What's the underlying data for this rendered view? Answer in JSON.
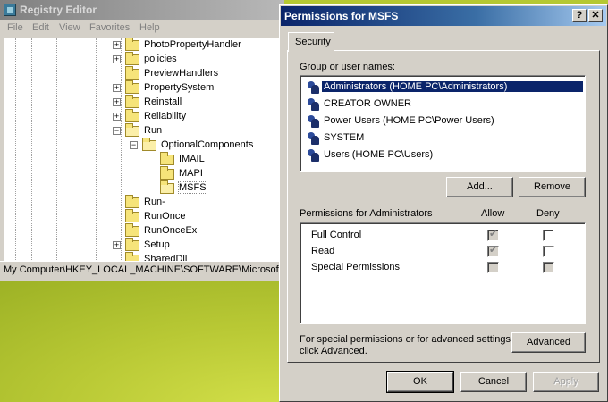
{
  "registry": {
    "title": "Registry Editor",
    "menu": [
      "File",
      "Edit",
      "View",
      "Favorites",
      "Help"
    ],
    "tree": [
      {
        "label": "PhotoPropertyHandler",
        "expander": "+",
        "level": 0
      },
      {
        "label": "policies",
        "expander": "+",
        "level": 0
      },
      {
        "label": "PreviewHandlers",
        "expander": "",
        "level": 0
      },
      {
        "label": "PropertySystem",
        "expander": "+",
        "level": 0
      },
      {
        "label": "Reinstall",
        "expander": "+",
        "level": 0
      },
      {
        "label": "Reliability",
        "expander": "+",
        "level": 0
      },
      {
        "label": "Run",
        "expander": "−",
        "level": 0
      },
      {
        "label": "OptionalComponents",
        "expander": "−",
        "level": 1
      },
      {
        "label": "IMAIL",
        "expander": "",
        "level": 2
      },
      {
        "label": "MAPI",
        "expander": "",
        "level": 2
      },
      {
        "label": "MSFS",
        "expander": "",
        "level": 2
      },
      {
        "label": "Run-",
        "expander": "",
        "level": 0
      },
      {
        "label": "RunOnce",
        "expander": "",
        "level": 0
      },
      {
        "label": "RunOnceEx",
        "expander": "",
        "level": 0
      },
      {
        "label": "Setup",
        "expander": "+",
        "level": 0
      },
      {
        "label": "SharedDll",
        "expander": "",
        "level": 0
      }
    ],
    "status": "My Computer\\HKEY_LOCAL_MACHINE\\SOFTWARE\\Microsoft\\Wi"
  },
  "dialog": {
    "title": "Permissions for MSFS",
    "help_btn": "?",
    "close_btn": "✕",
    "tab": "Security",
    "group_label": "Group or user names:",
    "users": [
      "Administrators (HOME PC\\Administrators)",
      "CREATOR OWNER",
      "Power Users (HOME PC\\Power Users)",
      "SYSTEM",
      "Users (HOME PC\\Users)"
    ],
    "add_btn": "Add...",
    "remove_btn": "Remove",
    "perm_header": "Permissions for Administrators",
    "allow_header": "Allow",
    "deny_header": "Deny",
    "permissions": [
      {
        "name": "Full Control",
        "allow": "checked-grey",
        "deny": "empty"
      },
      {
        "name": "Read",
        "allow": "checked-grey",
        "deny": "empty"
      },
      {
        "name": "Special Permissions",
        "allow": "grey",
        "deny": "grey"
      }
    ],
    "advanced_text_1": "For special permissions or for advanced settings,",
    "advanced_text_2": "click Advanced.",
    "advanced_btn": "Advanced",
    "ok_btn": "OK",
    "cancel_btn": "Cancel",
    "apply_btn": "Apply"
  }
}
